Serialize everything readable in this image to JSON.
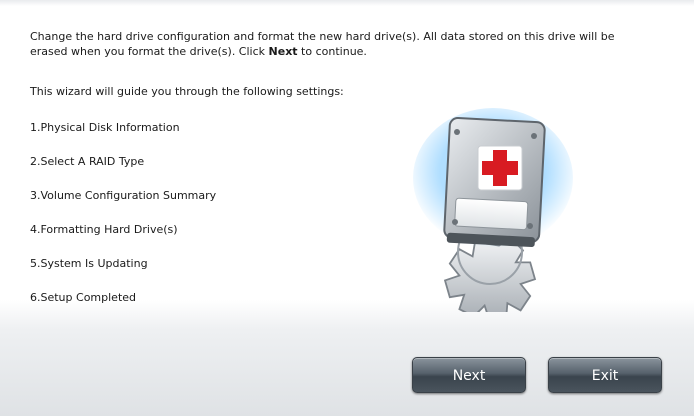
{
  "intro": {
    "text_before": "Change the hard drive configuration and format the new hard drive(s). All data stored on this drive will be erased when you format the drive(s). Click ",
    "bold_word": "Next",
    "text_after": " to continue."
  },
  "guide_text": "This wizard will guide you through the following settings:",
  "steps": [
    "1.Physical Disk Information",
    "2.Select A RAID Type",
    "3.Volume Configuration Summary",
    "4.Formatting Hard Drive(s)",
    "5.System Is Updating",
    "6.Setup Completed"
  ],
  "buttons": {
    "next_label": "Next",
    "exit_label": "Exit"
  },
  "illustration": {
    "icon": "hard-drive-gear-medical-cross-icon",
    "cross_color": "#d81b22",
    "glow_color": "#6fc3ff"
  }
}
